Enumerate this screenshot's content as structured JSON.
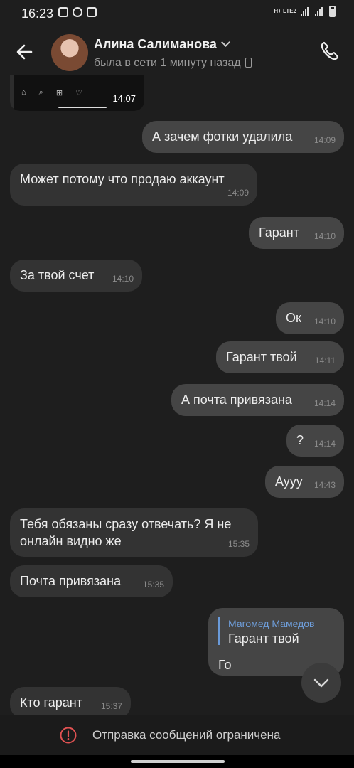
{
  "status_bar": {
    "time": "16:23",
    "network": "H+ LTE2"
  },
  "header": {
    "contact_name": "Алина Салиманова",
    "contact_status": "была в сети 1 минуту назад"
  },
  "preview": {
    "time": "14:07"
  },
  "messages": [
    {
      "text": "А зачем фотки удалила",
      "time": "14:09"
    },
    {
      "text": "Может потому что продаю аккаунт",
      "time": "14:09"
    },
    {
      "text": "Гарант",
      "time": "14:10"
    },
    {
      "text": "За твой счет",
      "time": "14:10"
    },
    {
      "text": "Ок",
      "time": "14:10"
    },
    {
      "text": "Гарант твой",
      "time": "14:11"
    },
    {
      "text": "А почта привязана",
      "time": "14:14"
    },
    {
      "text": "?",
      "time": "14:14"
    },
    {
      "text": "Аууу",
      "time": "14:43"
    },
    {
      "text": "Тебя обязаны сразу отвечать? Я не онлайн видно же",
      "time": "15:35"
    },
    {
      "text": "Почта привязана",
      "time": "15:35"
    },
    {
      "reply_author": "Магомед Мамедов",
      "reply_text": "Гарант твой",
      "text": "Го"
    },
    {
      "text": "Кто гарант",
      "time": "15:37"
    }
  ],
  "bottom": {
    "restricted_text": "Отправка сообщений ограничена"
  },
  "colors": {
    "background": "#1e1e1e",
    "incoming": "#333333",
    "outgoing": "#454545",
    "reply_accent": "#6f9fdc",
    "warning": "#e05252"
  }
}
